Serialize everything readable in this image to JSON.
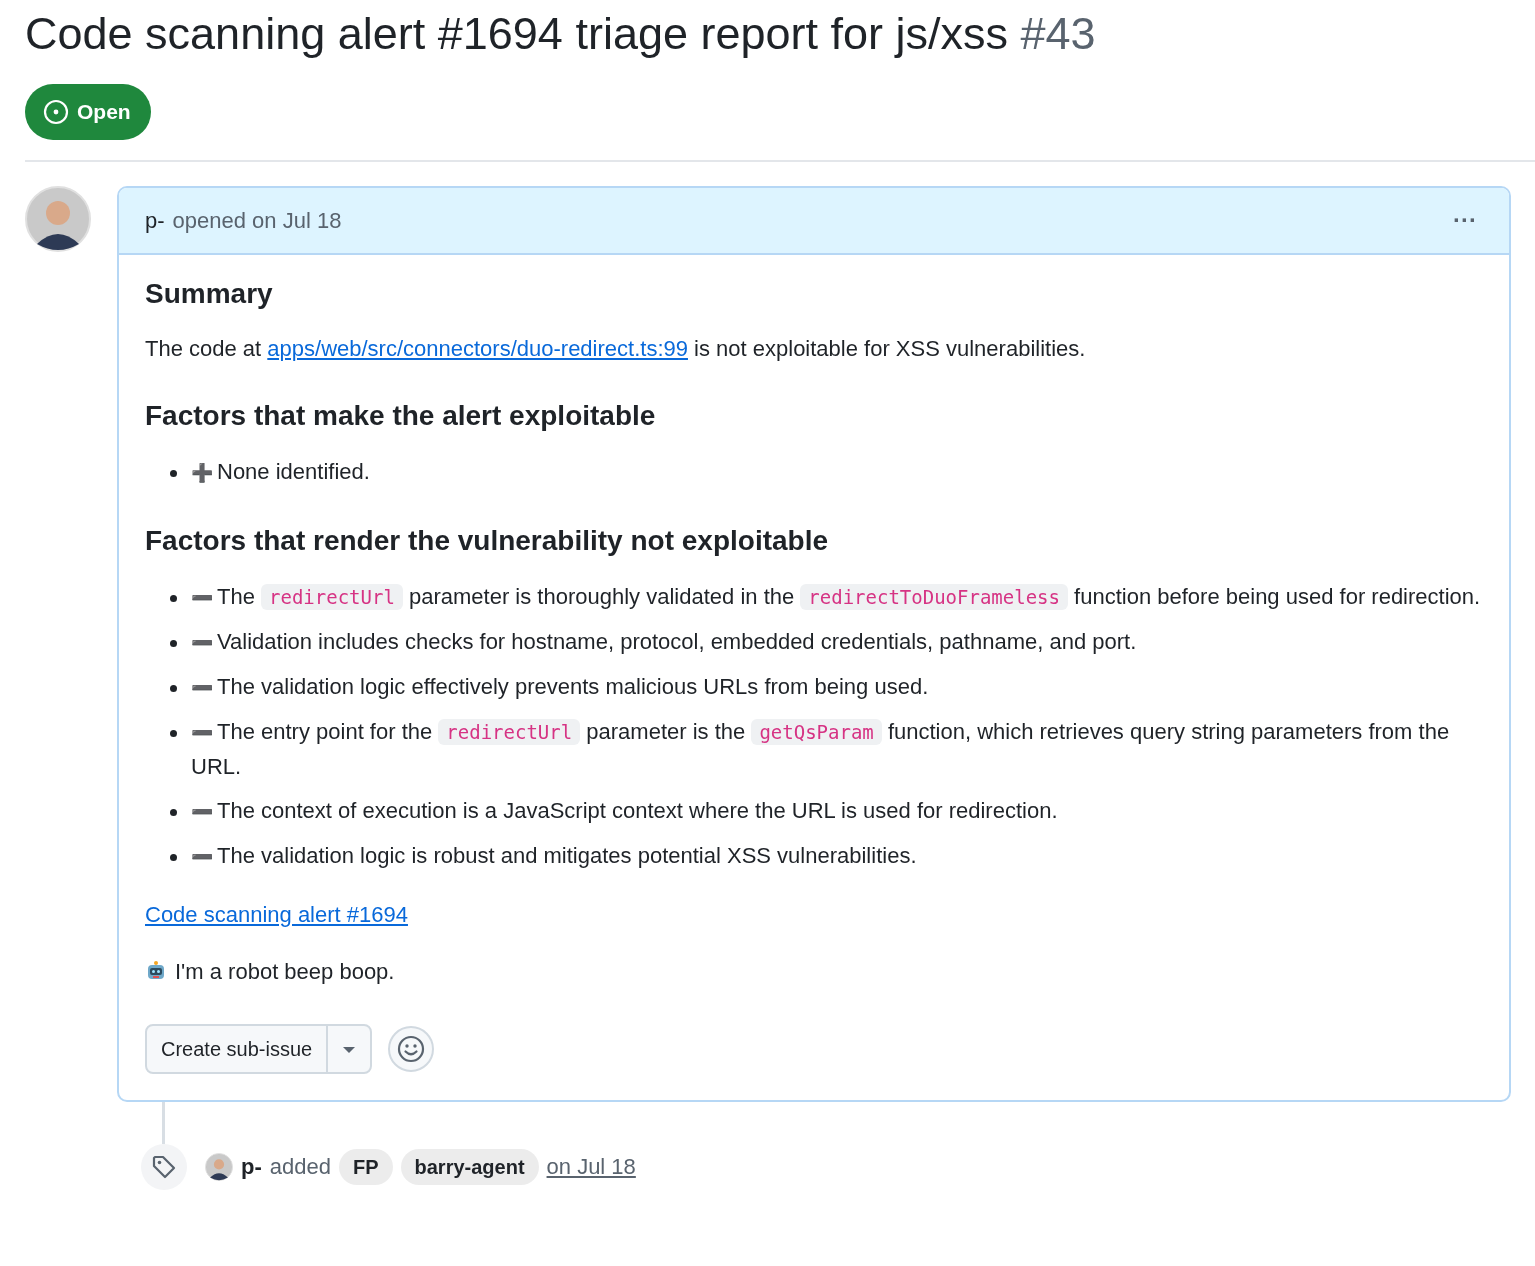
{
  "title": {
    "text": "Code scanning alert #1694 triage report for js/xss",
    "number": "#43"
  },
  "state": {
    "label": "Open",
    "kind": "open"
  },
  "comment": {
    "author": "p-",
    "action": "opened on Jul 18",
    "menu": "···",
    "summary_heading": "Summary",
    "summary": {
      "before": "The code at ",
      "link": "apps/web/src/connectors/duo-redirect.ts:99",
      "after": " is not exploitable for XSS vulnerabilities."
    },
    "sections": [
      {
        "heading": "Factors that make the alert exploitable",
        "items": [
          {
            "marker": "➕",
            "segments": [
              {
                "text": "None identified."
              }
            ]
          }
        ]
      },
      {
        "heading": "Factors that render the vulnerability not exploitable",
        "items": [
          {
            "marker": "➖",
            "segments": [
              {
                "text": "The "
              },
              {
                "code": "redirectUrl"
              },
              {
                "text": " parameter is thoroughly validated in the "
              },
              {
                "code": "redirectToDuoFrameless"
              },
              {
                "text": " function before being used for redirection."
              }
            ]
          },
          {
            "marker": "➖",
            "segments": [
              {
                "text": "Validation includes checks for hostname, protocol, embedded credentials, pathname, and port."
              }
            ]
          },
          {
            "marker": "➖",
            "segments": [
              {
                "text": "The validation logic effectively prevents malicious URLs from being used."
              }
            ]
          },
          {
            "marker": "➖",
            "segments": [
              {
                "text": "The entry point for the "
              },
              {
                "code": "redirectUrl"
              },
              {
                "text": " parameter is the "
              },
              {
                "code": "getQsParam"
              },
              {
                "text": " function, which retrieves query string parameters from the URL."
              }
            ]
          },
          {
            "marker": "➖",
            "segments": [
              {
                "text": "The context of execution is a JavaScript context where the URL is used for redirection."
              }
            ]
          },
          {
            "marker": "➖",
            "segments": [
              {
                "text": "The validation logic is robust and mitigates potential XSS vulnerabilities."
              }
            ]
          }
        ]
      }
    ],
    "alert_link": "Code scanning alert #1694",
    "robot_note": "I'm a robot beep boop.",
    "create_button": "Create sub-issue"
  },
  "event": {
    "author": "p-",
    "action": "added",
    "labels": [
      "FP",
      "barry-agent"
    ],
    "time": "on Jul 18"
  }
}
